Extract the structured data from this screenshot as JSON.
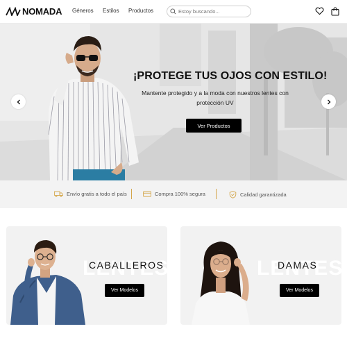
{
  "header": {
    "brand": "NOMADA",
    "nav": [
      "Géneros",
      "Estilos",
      "Productos"
    ],
    "search_placeholder": "Estoy buscando...",
    "icons": [
      "search-icon",
      "heart-icon",
      "shopping-bag-icon"
    ]
  },
  "hero": {
    "title": "¡PROTEGE TUS OJOS CON ESTILO!",
    "subtitle": "Mantente protegido y a la moda con nuestros lentes a tu protección UV",
    "subtitle_lines": [
      "Mantente protegido y a la moda con nuestros lentes con",
      "protección UV"
    ],
    "cta": "Ver Productos"
  },
  "features": [
    {
      "label": "Envío gratis a todo el país",
      "icon": "truck-icon"
    },
    {
      "label": "Compra 100% segura",
      "icon": "credit-card-icon"
    },
    {
      "label": "Calidad garantizada",
      "icon": "shield-check-icon"
    }
  ],
  "categories": [
    {
      "title": "CABALLEROS",
      "bg_word": "LENTES",
      "cta": "Ver Modelos"
    },
    {
      "title": "DAMAS",
      "bg_word": "LENTES",
      "cta": "Ver Modelos"
    }
  ],
  "colors": {
    "accent": "#d4a64a",
    "button": "#000000",
    "feature_icon": "#d4a64a"
  }
}
